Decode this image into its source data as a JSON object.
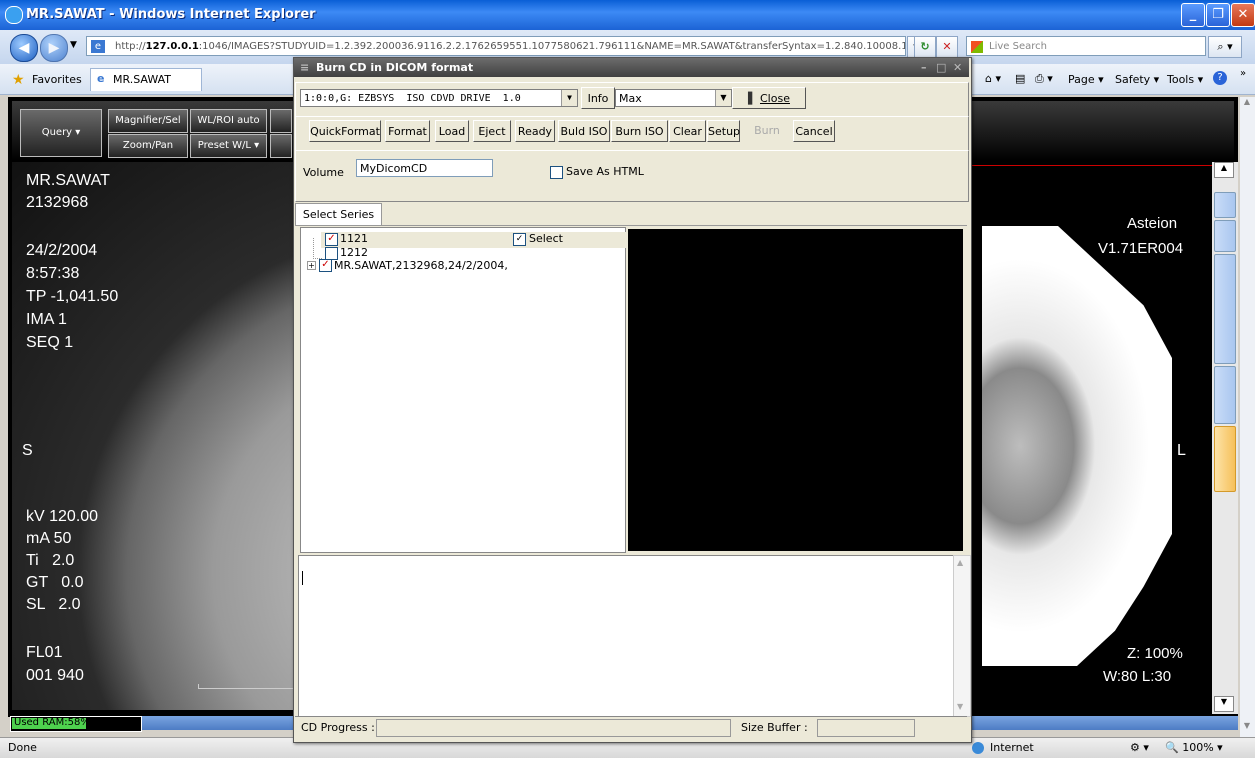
{
  "ie": {
    "window_title": "MR.SAWAT - Windows Internet Explorer",
    "url_prefix": "http://",
    "url_host": "127.0.0.1",
    "url_rest": ":1046/IMAGES?STUDYUID=1.2.392.200036.9116.2.2.1762659551.1077580621.796111&NAME=MR.SAWAT&transferSyntax=1.2.840.10008.1.2",
    "search_placeholder": "Live Search",
    "favorites_label": "Favorites",
    "tab_label": "MR.SAWAT",
    "page_menu": "Page",
    "safety_menu": "Safety",
    "tools_menu": "Tools",
    "status_done": "Done",
    "status_zone": "Internet",
    "status_zoom": "100%"
  },
  "viewer": {
    "query_label": "Query",
    "magnifier_label": "Magnifier/Sel",
    "wl_roi_label": "WL/ROI auto",
    "zoom_pan_label": "Zoom/Pan",
    "preset_wl_label": "Preset W/L",
    "left_overlay": {
      "name": "MR.SAWAT",
      "id": "2132968",
      "date": "24/2/2004",
      "time": "8:57:38",
      "tp": "TP -1,041.50",
      "ima": "IMA 1",
      "seq": "SEQ 1",
      "side": "S",
      "kv": "kV 120.00",
      "ma": "mA 50",
      "ti": "Ti   2.0",
      "gt": "GT   0.0",
      "sl": "SL   2.0",
      "fl": "FL01",
      "num": "001 940"
    },
    "right_overlay": {
      "vendor": "Asteion",
      "version": "V1.71ER004",
      "side": "L",
      "zoom": "Z: 100%",
      "wl": "W:80 L:30"
    },
    "ram_label": "Used RAM:58%",
    "ram_percent": 58
  },
  "dialog": {
    "title": "Burn CD in DICOM format",
    "drive": "1:0:0,G: EZBSYS  ISO CDVD DRIVE  1.0",
    "info_label": "Info",
    "speed": "Max",
    "close_label": "Close",
    "buttons": [
      "QuickFormat",
      "Format",
      "Load",
      "Eject",
      "Ready",
      "Buld ISO",
      "Burn ISO",
      "Clear",
      "Setup",
      "Burn",
      "Cancel"
    ],
    "volume_label": "Volume",
    "volume_value": "MyDicomCD",
    "save_html_label": "Save As HTML",
    "tab_label": "Select Series",
    "tree": [
      {
        "label": "1121",
        "checked": true
      },
      {
        "label": "1212",
        "checked": false
      },
      {
        "label": "MR.SAWAT,2132968,24/2/2004,",
        "checked": true
      }
    ],
    "select_label": "Select",
    "cd_progress_label": "CD Progress :",
    "size_buffer_label": "Size Buffer :"
  }
}
